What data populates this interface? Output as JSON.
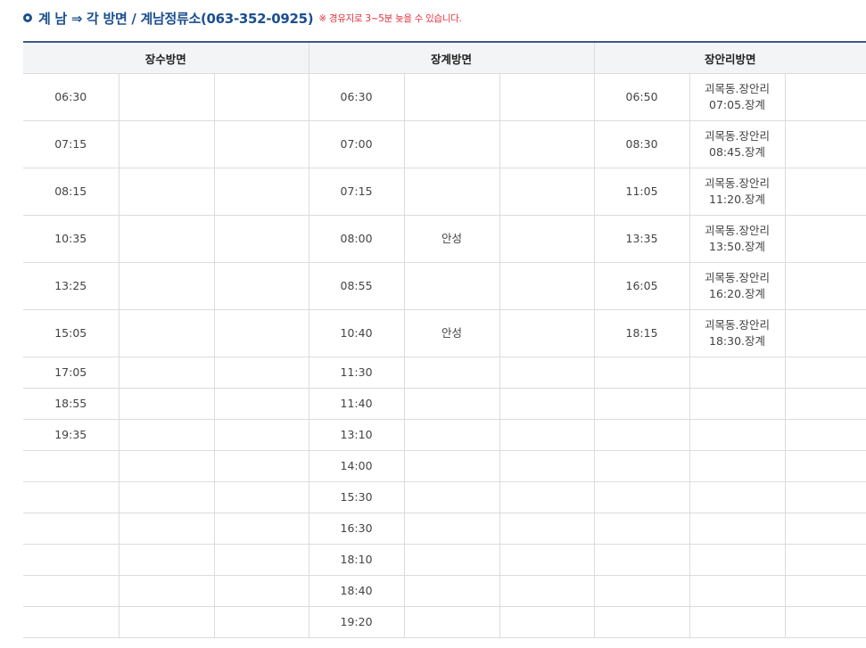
{
  "heading": {
    "title": "계 남 ⇒ 각 방면 / 계남정류소(063-352-0925)",
    "note": "※ 경유지로 3~5분 늦을 수 있습니다."
  },
  "table": {
    "headers": [
      "장수방면",
      "장계방면",
      "장안리방면"
    ],
    "rows": [
      [
        "06:30",
        "",
        "",
        "06:30",
        "",
        "",
        "06:50",
        "괴목동.장안리\n07:05.장계",
        ""
      ],
      [
        "07:15",
        "",
        "",
        "07:00",
        "",
        "",
        "08:30",
        "괴목동.장안리\n08:45.장계",
        ""
      ],
      [
        "08:15",
        "",
        "",
        "07:15",
        "",
        "",
        "11:05",
        "괴목동.장안리\n11:20.장계",
        ""
      ],
      [
        "10:35",
        "",
        "",
        "08:00",
        "안성",
        "",
        "13:35",
        "괴목동.장안리\n13:50.장계",
        ""
      ],
      [
        "13:25",
        "",
        "",
        "08:55",
        "",
        "",
        "16:05",
        "괴목동.장안리\n16:20.장계",
        ""
      ],
      [
        "15:05",
        "",
        "",
        "10:40",
        "안성",
        "",
        "18:15",
        "괴목동.장안리\n18:30.장계",
        ""
      ],
      [
        "17:05",
        "",
        "",
        "11:30",
        "",
        "",
        "",
        "",
        ""
      ],
      [
        "18:55",
        "",
        "",
        "11:40",
        "",
        "",
        "",
        "",
        ""
      ],
      [
        "19:35",
        "",
        "",
        "13:10",
        "",
        "",
        "",
        "",
        ""
      ],
      [
        "",
        "",
        "",
        "14:00",
        "",
        "",
        "",
        "",
        ""
      ],
      [
        "",
        "",
        "",
        "15:30",
        "",
        "",
        "",
        "",
        ""
      ],
      [
        "",
        "",
        "",
        "16:30",
        "",
        "",
        "",
        "",
        ""
      ],
      [
        "",
        "",
        "",
        "18:10",
        "",
        "",
        "",
        "",
        ""
      ],
      [
        "",
        "",
        "",
        "18:40",
        "",
        "",
        "",
        "",
        ""
      ],
      [
        "",
        "",
        "",
        "19:20",
        "",
        "",
        "",
        "",
        ""
      ]
    ]
  }
}
